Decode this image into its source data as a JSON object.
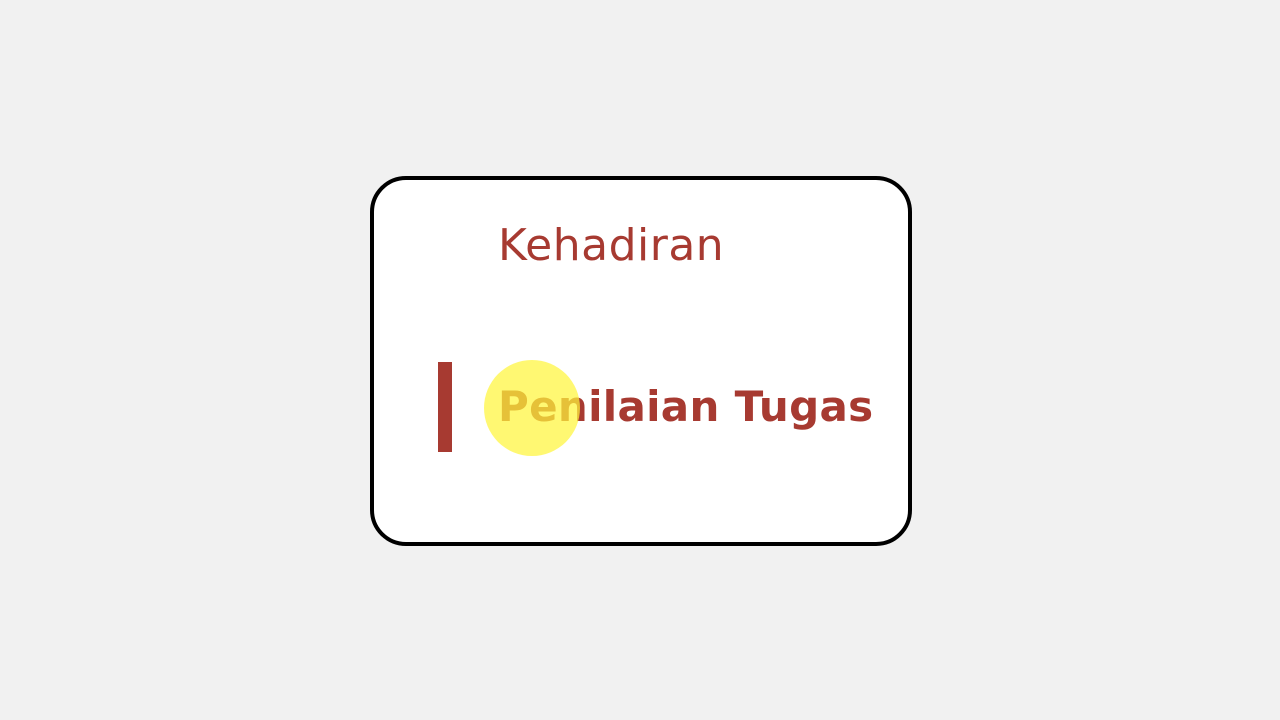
{
  "menu": {
    "items": [
      {
        "label": "Kehadiran",
        "active": false
      },
      {
        "label": "Penilaian Tugas",
        "active": true
      }
    ]
  },
  "colors": {
    "page_background": "#f1f1f1",
    "card_background": "#ffffff",
    "card_border": "#000000",
    "accent": "#a73a31",
    "click_highlight": "#fff53c"
  }
}
